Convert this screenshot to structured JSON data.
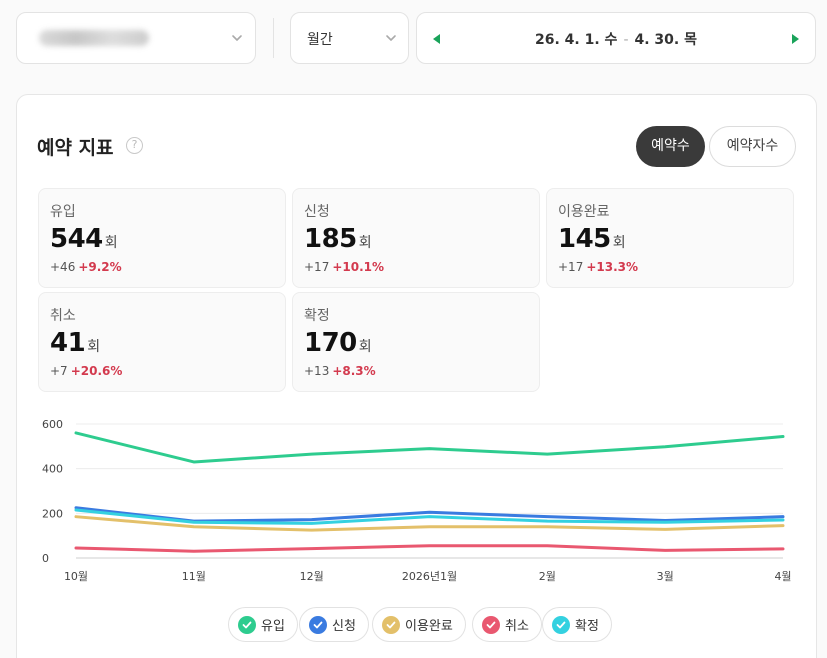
{
  "filters": {
    "period_label": "월간",
    "date_start": "26. 4. 1. 수",
    "date_sep": "-",
    "date_end": "4. 30. 목"
  },
  "card": {
    "title": "예약 지표",
    "toggle_active": "예약수",
    "toggle_inactive": "예약자수"
  },
  "stats": [
    {
      "label": "유입",
      "value": "544",
      "unit": "회",
      "delta": "+46",
      "pct": "+9.2%"
    },
    {
      "label": "신청",
      "value": "185",
      "unit": "회",
      "delta": "+17",
      "pct": "+10.1%"
    },
    {
      "label": "이용완료",
      "value": "145",
      "unit": "회",
      "delta": "+17",
      "pct": "+13.3%"
    },
    {
      "label": "취소",
      "value": "41",
      "unit": "회",
      "delta": "+7",
      "pct": "+20.6%"
    },
    {
      "label": "확정",
      "value": "170",
      "unit": "회",
      "delta": "+13",
      "pct": "+8.3%"
    }
  ],
  "colors": {
    "유입": "#2ecc8f",
    "신청": "#3a7be0",
    "이용완료": "#e3c06a",
    "취소": "#e95870",
    "확정": "#34d1e0",
    "positive_change": "#d33a4e",
    "nav_arrow": "#1aa35a"
  },
  "chart_data": {
    "type": "line",
    "categories": [
      "10월",
      "11월",
      "12월",
      "2026년1월",
      "2월",
      "3월",
      "4월"
    ],
    "ylim": [
      0,
      600
    ],
    "yticks": [
      0,
      200,
      400,
      600
    ],
    "grid": true,
    "series": [
      {
        "name": "유입",
        "values": [
          560,
          430,
          465,
          490,
          465,
          498,
          544
        ]
      },
      {
        "name": "신청",
        "values": [
          225,
          165,
          172,
          205,
          185,
          168,
          185
        ]
      },
      {
        "name": "이용완료",
        "values": [
          185,
          140,
          125,
          140,
          140,
          128,
          145
        ]
      },
      {
        "name": "취소",
        "values": [
          45,
          30,
          42,
          55,
          55,
          34,
          41
        ]
      },
      {
        "name": "확정",
        "values": [
          215,
          160,
          155,
          185,
          165,
          160,
          170
        ]
      }
    ]
  },
  "legend": [
    {
      "name": "유입"
    },
    {
      "name": "신청"
    },
    {
      "name": "이용완료"
    },
    {
      "name": "취소"
    },
    {
      "name": "확정"
    }
  ]
}
